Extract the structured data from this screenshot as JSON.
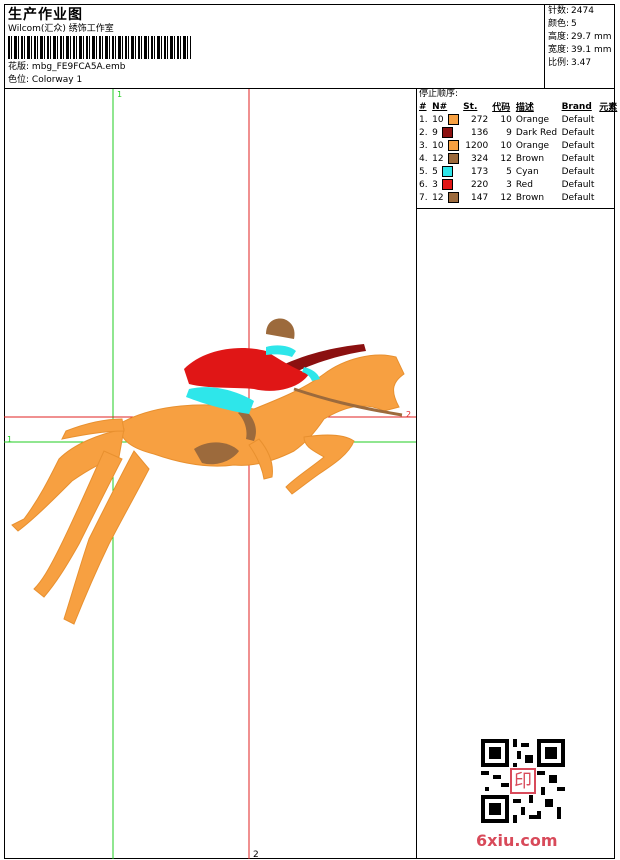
{
  "header": {
    "title": "生产作业图",
    "company": "Wilcom(汇众) 绣饰工作室",
    "design_file_label": "花版:",
    "design_file": "mbg_FE9FCA5A.emb",
    "colorway_label": "色位:",
    "colorway": "Colorway 1"
  },
  "stats": [
    {
      "label": "针数:",
      "value": "2474"
    },
    {
      "label": "颜色:",
      "value": "5"
    },
    {
      "label": "高度:",
      "value": "29.7 mm"
    },
    {
      "label": "宽度:",
      "value": "39.1 mm"
    },
    {
      "label": "比例:",
      "value": "3.47"
    }
  ],
  "stop_sequence": {
    "title": "停止顺序:",
    "columns": [
      "#",
      "N#",
      "St.",
      "代码",
      "描述",
      "Brand",
      "元素"
    ],
    "rows": [
      {
        "idx": "1.",
        "n": "10",
        "color": "#f7a041",
        "st": "272",
        "code": "10",
        "desc": "Orange",
        "brand": "Default"
      },
      {
        "idx": "2.",
        "n": "9",
        "color": "#8b1010",
        "st": "136",
        "code": "9",
        "desc": "Dark Red",
        "brand": "Default"
      },
      {
        "idx": "3.",
        "n": "10",
        "color": "#f7a041",
        "st": "1200",
        "code": "10",
        "desc": "Orange",
        "brand": "Default"
      },
      {
        "idx": "4.",
        "n": "12",
        "color": "#9c6a3c",
        "st": "324",
        "code": "12",
        "desc": "Brown",
        "brand": "Default"
      },
      {
        "idx": "5.",
        "n": "5",
        "color": "#2ee6ea",
        "st": "173",
        "code": "5",
        "desc": "Cyan",
        "brand": "Default"
      },
      {
        "idx": "6.",
        "n": "3",
        "color": "#e01616",
        "st": "220",
        "code": "3",
        "desc": "Red",
        "brand": "Default"
      },
      {
        "idx": "7.",
        "n": "12",
        "color": "#9c6a3c",
        "st": "147",
        "code": "12",
        "desc": "Brown",
        "brand": "Default"
      }
    ]
  },
  "axes": {
    "green_label": "1",
    "red_label": "2",
    "green_color": "#22cc22",
    "red_color": "#e02020"
  },
  "watermark": {
    "site": "6xiu.com",
    "seal": "印"
  }
}
